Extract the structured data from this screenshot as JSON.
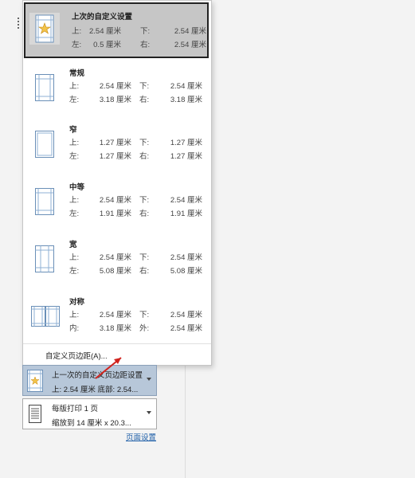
{
  "presets": [
    {
      "name": "上次的自定义设置",
      "labels": [
        "上:",
        "下:",
        "左:",
        "右:"
      ],
      "values": [
        "2.54 厘米",
        "2.54 厘米",
        "0.5 厘米",
        "2.54 厘米"
      ],
      "icon": "star-page-icon"
    },
    {
      "name": "常规",
      "labels": [
        "上:",
        "下:",
        "左:",
        "右:"
      ],
      "values": [
        "2.54 厘米",
        "2.54 厘米",
        "3.18 厘米",
        "3.18 厘米"
      ],
      "icon": "page-margins-icon"
    },
    {
      "name": "窄",
      "labels": [
        "上:",
        "下:",
        "左:",
        "右:"
      ],
      "values": [
        "1.27 厘米",
        "1.27 厘米",
        "1.27 厘米",
        "1.27 厘米"
      ],
      "icon": "page-margins-icon"
    },
    {
      "name": "中等",
      "labels": [
        "上:",
        "下:",
        "左:",
        "右:"
      ],
      "values": [
        "2.54 厘米",
        "2.54 厘米",
        "1.91 厘米",
        "1.91 厘米"
      ],
      "icon": "page-margins-icon"
    },
    {
      "name": "宽",
      "labels": [
        "上:",
        "下:",
        "左:",
        "右:"
      ],
      "values": [
        "2.54 厘米",
        "2.54 厘米",
        "5.08 厘米",
        "5.08 厘米"
      ],
      "icon": "page-margins-icon"
    },
    {
      "name": "对称",
      "labels": [
        "上:",
        "下:",
        "内:",
        "外:"
      ],
      "values": [
        "2.54 厘米",
        "2.54 厘米",
        "3.18 厘米",
        "2.54 厘米"
      ],
      "icon": "mirrored-pages-icon"
    }
  ],
  "menu_footer": {
    "custom_margins_label": "自定义页边距(A)..."
  },
  "margin_control": {
    "line1": "上一次的自定义页边距设置",
    "line2": "上: 2.54 厘米 底部: 2.54..."
  },
  "pages_control": {
    "line1": "每版打印 1 页",
    "line2": "缩放到 14 厘米 x 20.3..."
  },
  "page_setup_link": "页面设置",
  "colors": {
    "selected_bg": "#c6c6c6",
    "accent_blue": "#1f5fa8",
    "arrow_red": "#d0231e"
  }
}
